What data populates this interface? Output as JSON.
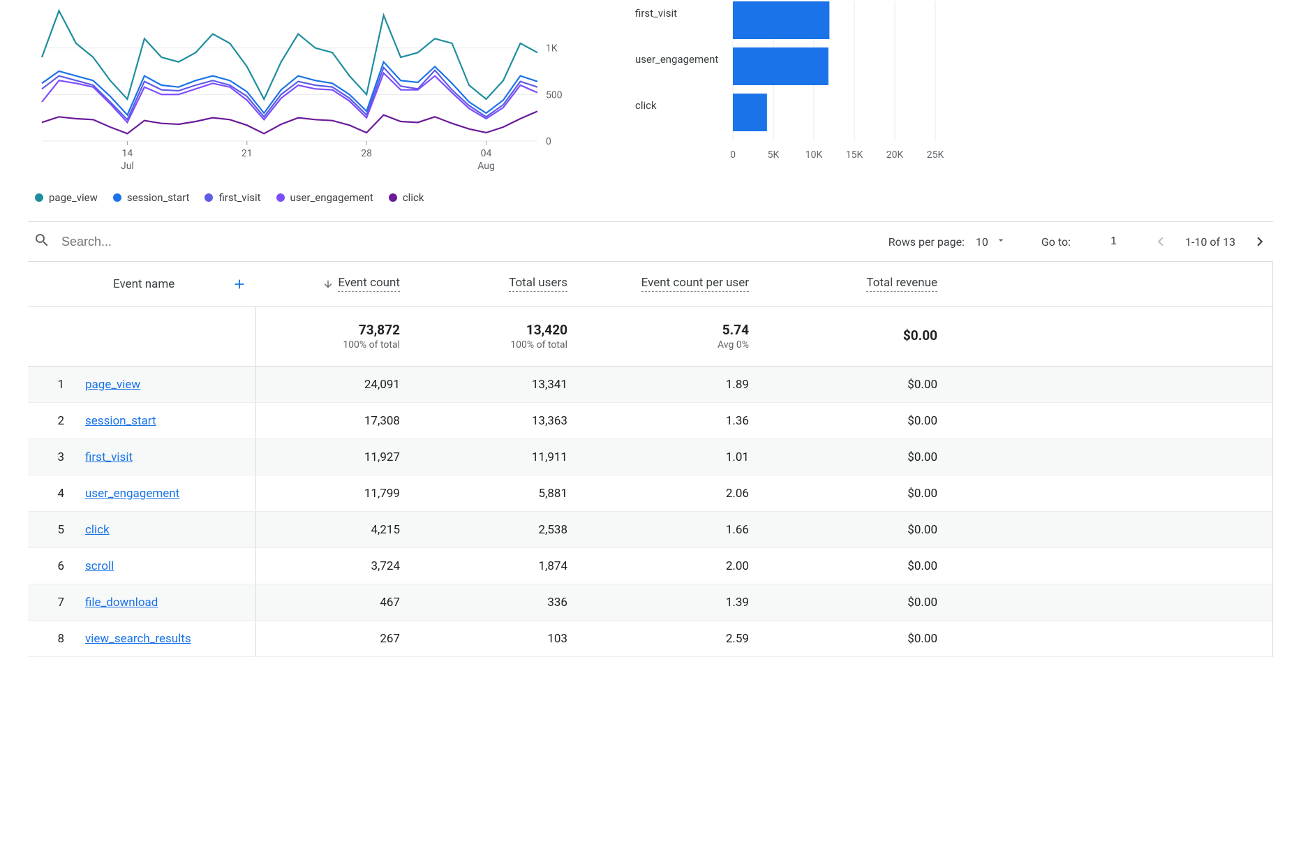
{
  "chart_data": [
    {
      "type": "line",
      "x_ticks": [
        {
          "major": "14",
          "minor": "Jul"
        },
        {
          "major": "21",
          "minor": ""
        },
        {
          "major": "28",
          "minor": ""
        },
        {
          "major": "04",
          "minor": "Aug"
        }
      ],
      "y_ticks": [
        "0",
        "500",
        "1K"
      ],
      "ylim": [
        0,
        1500
      ],
      "colors": {
        "page_view": "#1e8e9e",
        "session_start": "#1a73e8",
        "first_visit": "#5e5ce6",
        "user_engagement": "#7c4dff",
        "click": "#6a1b9a"
      },
      "series": [
        {
          "name": "page_view",
          "values": [
            900,
            1400,
            1050,
            900,
            650,
            450,
            1100,
            900,
            850,
            950,
            1150,
            1050,
            800,
            450,
            850,
            1150,
            1000,
            950,
            700,
            500,
            1350,
            900,
            950,
            1100,
            1050,
            600,
            450,
            650,
            1050,
            950
          ]
        },
        {
          "name": "session_start",
          "values": [
            620,
            750,
            700,
            650,
            480,
            280,
            700,
            600,
            580,
            650,
            700,
            650,
            530,
            300,
            550,
            700,
            650,
            620,
            500,
            320,
            850,
            650,
            630,
            800,
            620,
            420,
            300,
            440,
            700,
            640
          ]
        },
        {
          "name": "first_visit",
          "values": [
            560,
            700,
            650,
            600,
            420,
            230,
            640,
            550,
            540,
            600,
            650,
            600,
            480,
            260,
            500,
            640,
            600,
            580,
            460,
            280,
            790,
            590,
            560,
            760,
            550,
            380,
            260,
            390,
            640,
            580
          ]
        },
        {
          "name": "user_engagement",
          "values": [
            420,
            650,
            620,
            580,
            400,
            200,
            580,
            500,
            500,
            560,
            620,
            580,
            440,
            230,
            460,
            600,
            560,
            550,
            430,
            250,
            730,
            550,
            550,
            700,
            520,
            350,
            240,
            360,
            600,
            520
          ]
        },
        {
          "name": "click",
          "values": [
            200,
            260,
            240,
            230,
            150,
            80,
            220,
            190,
            180,
            210,
            250,
            230,
            170,
            80,
            180,
            250,
            230,
            220,
            170,
            90,
            280,
            210,
            200,
            260,
            190,
            130,
            90,
            150,
            240,
            320
          ]
        }
      ]
    },
    {
      "type": "bar",
      "orientation": "horizontal",
      "categories": [
        "first_visit",
        "user_engagement",
        "click"
      ],
      "values": [
        11927,
        11799,
        4215
      ],
      "xlim": [
        0,
        25000
      ],
      "x_ticks": [
        "0",
        "5K",
        "10K",
        "15K",
        "20K",
        "25K"
      ],
      "bar_color": "#1a73e8"
    }
  ],
  "legend": [
    "page_view",
    "session_start",
    "first_visit",
    "user_engagement",
    "click"
  ],
  "toolbar": {
    "search_placeholder": "Search...",
    "rows_per_page_label": "Rows per page:",
    "rows_per_page_value": "10",
    "goto_label": "Go to:",
    "goto_value": "1",
    "range_label": "1-10 of 13"
  },
  "table": {
    "columns": {
      "event_name": "Event name",
      "event_count": "Event count",
      "total_users": "Total users",
      "event_count_per_user": "Event count per user",
      "total_revenue": "Total revenue"
    },
    "totals": {
      "event_count": "73,872",
      "event_count_sub": "100% of total",
      "total_users": "13,420",
      "total_users_sub": "100% of total",
      "event_count_per_user": "5.74",
      "event_count_per_user_sub": "Avg 0%",
      "total_revenue": "$0.00",
      "total_revenue_sub": ""
    },
    "rows": [
      {
        "idx": "1",
        "name": "page_view",
        "event_count": "24,091",
        "total_users": "13,341",
        "per_user": "1.89",
        "revenue": "$0.00"
      },
      {
        "idx": "2",
        "name": "session_start",
        "event_count": "17,308",
        "total_users": "13,363",
        "per_user": "1.36",
        "revenue": "$0.00"
      },
      {
        "idx": "3",
        "name": "first_visit",
        "event_count": "11,927",
        "total_users": "11,911",
        "per_user": "1.01",
        "revenue": "$0.00"
      },
      {
        "idx": "4",
        "name": "user_engagement",
        "event_count": "11,799",
        "total_users": "5,881",
        "per_user": "2.06",
        "revenue": "$0.00"
      },
      {
        "idx": "5",
        "name": "click",
        "event_count": "4,215",
        "total_users": "2,538",
        "per_user": "1.66",
        "revenue": "$0.00"
      },
      {
        "idx": "6",
        "name": "scroll",
        "event_count": "3,724",
        "total_users": "1,874",
        "per_user": "2.00",
        "revenue": "$0.00"
      },
      {
        "idx": "7",
        "name": "file_download",
        "event_count": "467",
        "total_users": "336",
        "per_user": "1.39",
        "revenue": "$0.00"
      },
      {
        "idx": "8",
        "name": "view_search_results",
        "event_count": "267",
        "total_users": "103",
        "per_user": "2.59",
        "revenue": "$0.00"
      }
    ]
  }
}
